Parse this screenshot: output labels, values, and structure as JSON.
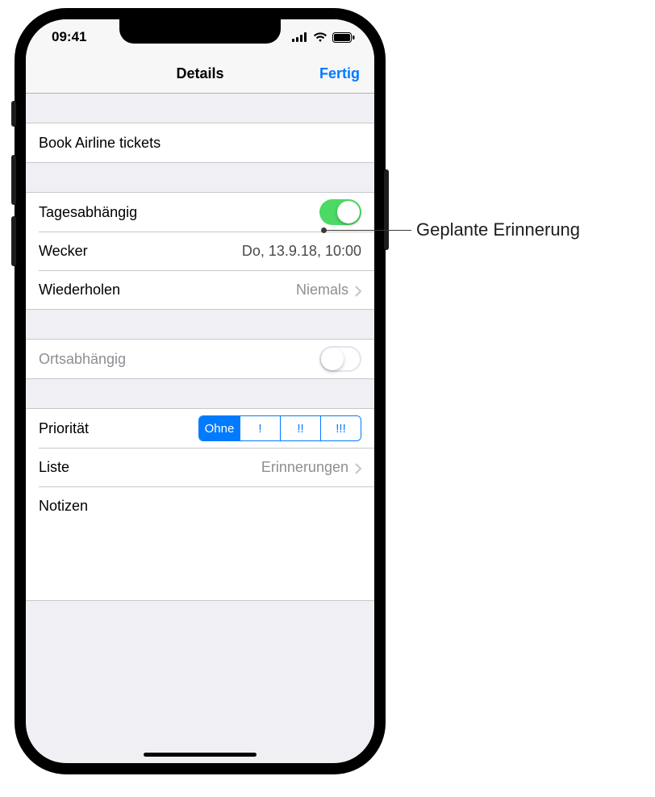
{
  "status": {
    "time": "09:41"
  },
  "nav": {
    "title": "Details",
    "done": "Fertig"
  },
  "reminder": {
    "title": "Book Airline tickets"
  },
  "date_section": {
    "day_toggle_label": "Tagesabhängig",
    "day_toggle_on": true,
    "alarm_label": "Wecker",
    "alarm_value": "Do, 13.9.18, 10:00",
    "repeat_label": "Wiederholen",
    "repeat_value": "Niemals"
  },
  "location_section": {
    "label": "Ortsabhängig",
    "on": false
  },
  "meta_section": {
    "priority_label": "Priorität",
    "priority_options": [
      "Ohne",
      "!",
      "!!",
      "!!!"
    ],
    "priority_selected": 0,
    "list_label": "Liste",
    "list_value": "Erinnerungen",
    "notes_label": "Notizen"
  },
  "callout": {
    "text": "Geplante Erinnerung"
  }
}
